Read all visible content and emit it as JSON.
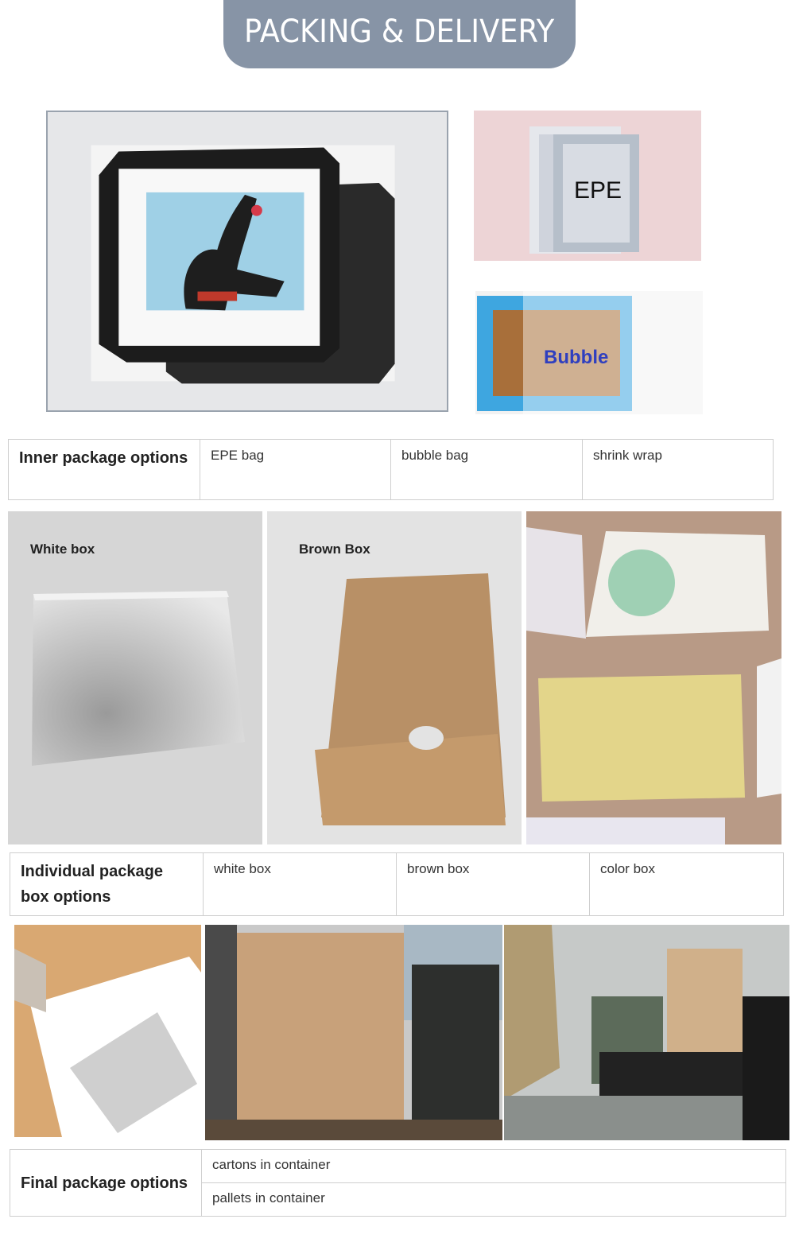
{
  "banner": {
    "title": "PACKING & DELIVERY"
  },
  "photos": {
    "epe_label": "EPE",
    "bubble_label": "Bubble",
    "white_box_label": "White box",
    "brown_box_label": "Brown Box"
  },
  "inner_package": {
    "header": "Inner package options",
    "options": [
      "EPE bag",
      "bubble bag",
      "shrink wrap"
    ]
  },
  "individual_package": {
    "header": "Individual package box options",
    "options": [
      "white box",
      "brown box",
      "color box"
    ]
  },
  "final_package": {
    "header": "Final package options",
    "options": [
      "cartons in container",
      "pallets in container"
    ]
  },
  "colors": {
    "banner": "#8794a6",
    "table_border": "#cfcfcf"
  }
}
